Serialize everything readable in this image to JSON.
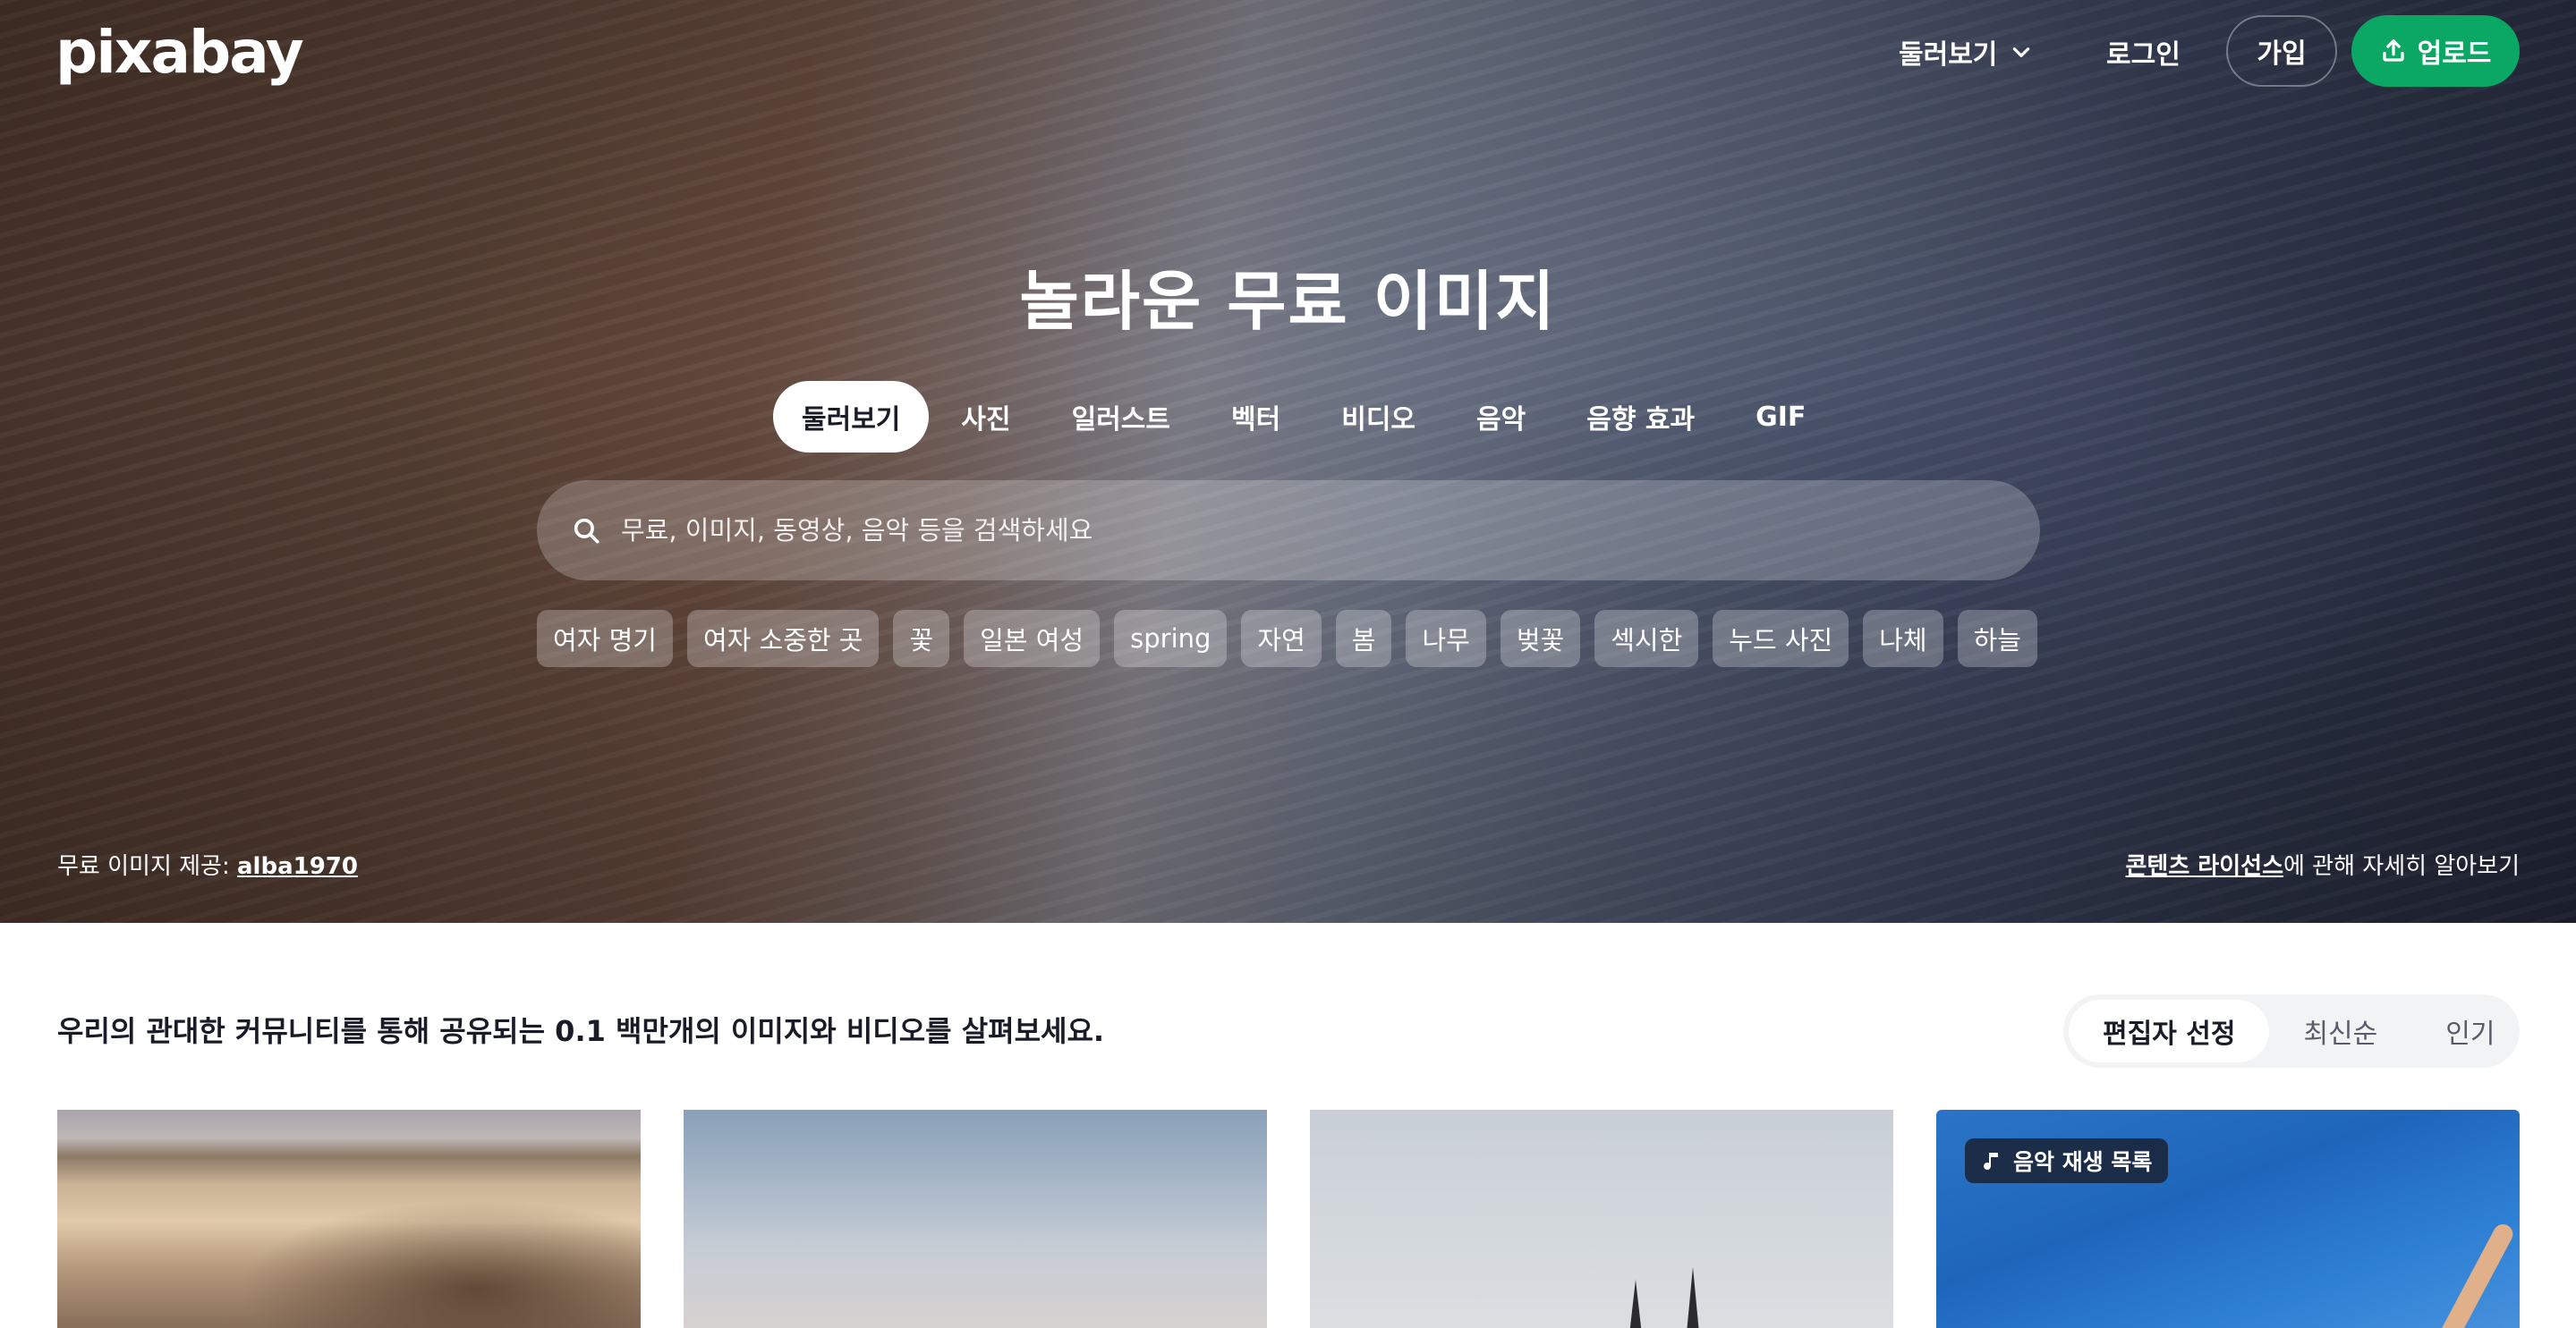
{
  "brand": {
    "logo": "pixabay"
  },
  "nav": {
    "explore_label": "둘러보기",
    "login_label": "로그인",
    "join_label": "가입",
    "upload_label": "업로드"
  },
  "hero": {
    "title": "놀라운 무료 이미지",
    "tabs": [
      "둘러보기",
      "사진",
      "일러스트",
      "벡터",
      "비디오",
      "음악",
      "음향 효과",
      "GIF"
    ],
    "active_tab": "둘러보기",
    "search": {
      "placeholder": "무료, 이미지, 동영상, 음악 등을 검색하세요",
      "value": ""
    },
    "tags": [
      "여자 명기",
      "여자 소중한 곳",
      "꽃",
      "일본 여성",
      "spring",
      "자연",
      "봄",
      "나무",
      "벚꽃",
      "섹시한",
      "누드 사진",
      "나체",
      "하늘"
    ],
    "credit_prefix": "무료 이미지 제공: ",
    "credit_user": "alba1970",
    "license_link": "콘텐츠 라이선스",
    "license_suffix": "에 관해 자세히 알아보기"
  },
  "content": {
    "intro": "우리의 관대한 커뮤니티를 통해 공유되는 0.1 백만개의 이미지와 비디오를 살펴보세요.",
    "sort_options": [
      "편집자 선정",
      "최신순",
      "인기"
    ],
    "active_sort": "편집자 선정",
    "playlist_badge": "음악 재생 목록"
  },
  "colors": {
    "accent": "#0aa864",
    "text_primary": "#191b26",
    "text_secondary": "#585b69",
    "sort_bg": "#f2f3f5"
  },
  "icons": {
    "explore": "chevron-down-icon",
    "upload": "upload-icon",
    "search": "search-icon",
    "playlist": "music-note-icon"
  }
}
